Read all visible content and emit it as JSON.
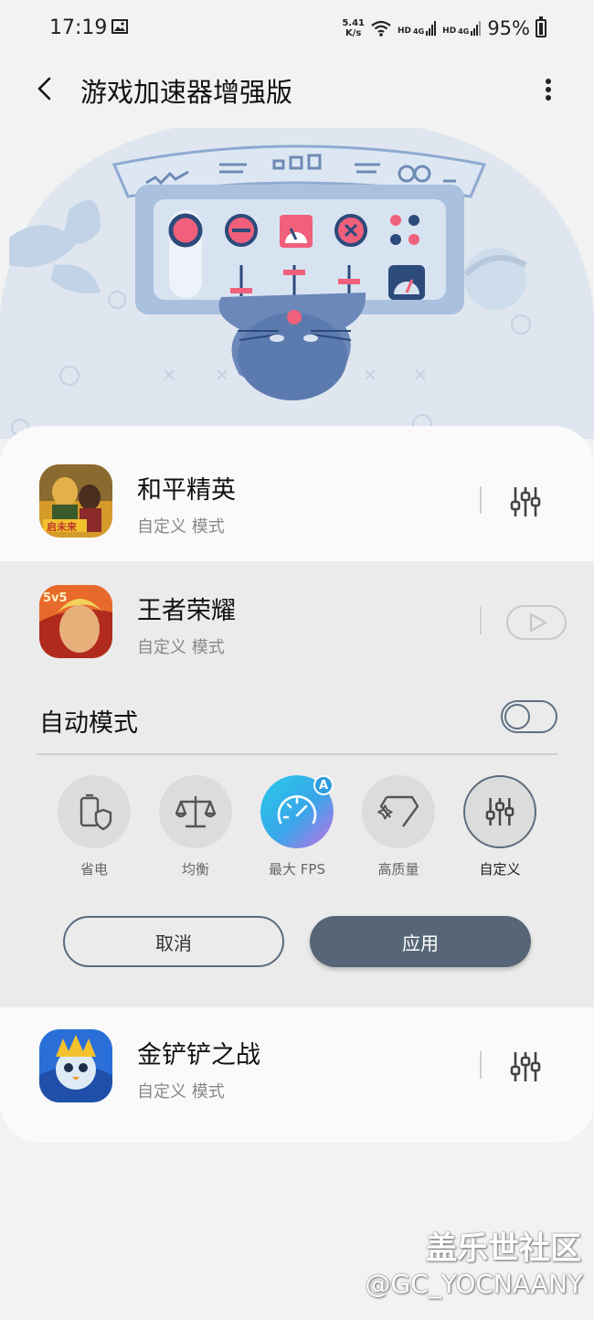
{
  "status_bar": {
    "time": "17:19",
    "net_speed_value": "5.41",
    "net_speed_unit": "K/s",
    "hd_label_1": "HD",
    "net_type_1": "4G",
    "hd_label_2": "HD",
    "net_type_2": "4G",
    "battery": "95%"
  },
  "app_bar": {
    "title": "游戏加速器增强版"
  },
  "games": [
    {
      "name": "和平精英",
      "mode": "自定义 模式",
      "action_icon": "sliders-icon"
    },
    {
      "name": "王者荣耀",
      "mode": "自定义 模式",
      "action_icon": "play-icon"
    },
    {
      "name": "金铲铲之战",
      "mode": "自定义 模式",
      "action_icon": "sliders-icon"
    }
  ],
  "expanded_panel": {
    "auto_mode_label": "自动模式",
    "auto_mode_on": false,
    "modes": [
      {
        "label": "省电",
        "icon": "battery-shield-icon",
        "selected": false
      },
      {
        "label": "均衡",
        "icon": "balance-scale-icon",
        "selected": false
      },
      {
        "label": "最大 FPS",
        "icon": "speedometer-icon",
        "selected": false,
        "badge": "A"
      },
      {
        "label": "高质量",
        "icon": "diamond-sparkle-icon",
        "selected": false
      },
      {
        "label": "自定义",
        "icon": "sliders-icon",
        "selected": true
      }
    ],
    "cancel_label": "取消",
    "apply_label": "应用"
  },
  "watermark": {
    "line1": "盖乐世社区",
    "line2": "@GC_YOCNAANY"
  },
  "colors": {
    "accent": "#566676",
    "pink": "#f0607a",
    "illustration_blue": "#a9c0de",
    "background": "#f2f2f2"
  }
}
